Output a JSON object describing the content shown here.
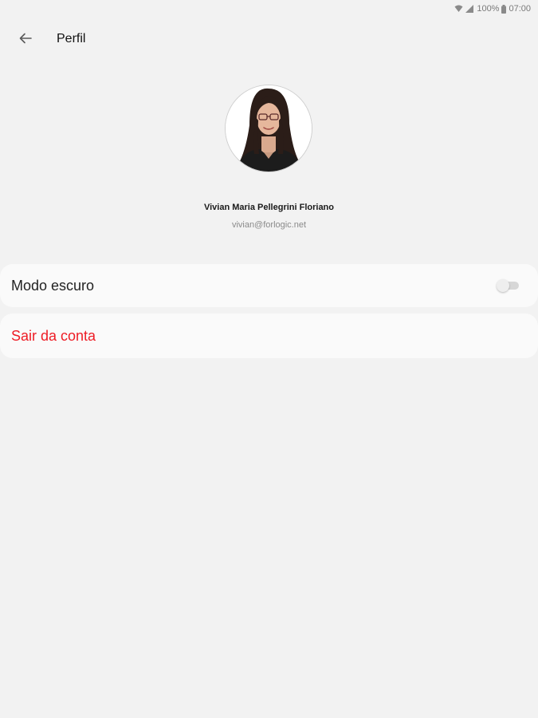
{
  "status_bar": {
    "battery_percent": "100%",
    "time": "07:00",
    "icons": [
      "wifi-icon",
      "signal-icon",
      "battery-icon"
    ]
  },
  "header": {
    "back_icon": "arrow-left-icon",
    "title": "Perfil"
  },
  "profile": {
    "name": "Vivian Maria Pellegrini Floriano",
    "email": "vivian@forlogic.net"
  },
  "settings": {
    "dark_mode_label": "Modo escuro",
    "dark_mode_enabled": false,
    "logout_label": "Sair da conta"
  },
  "colors": {
    "background": "#f2f2f2",
    "card": "#fafafa",
    "logout": "#ee1c25"
  }
}
